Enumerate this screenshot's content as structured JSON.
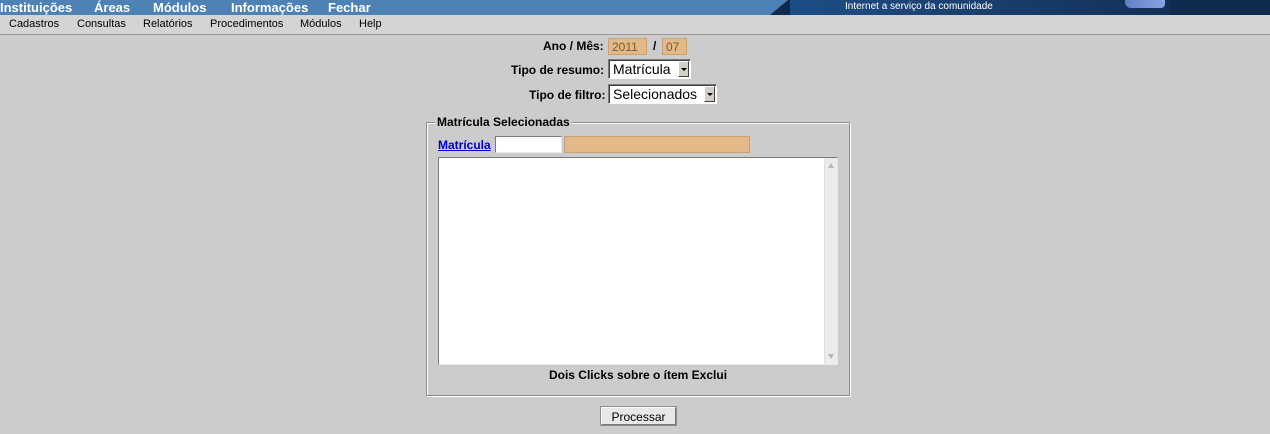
{
  "top_menu": {
    "items": [
      "Instituições",
      "Áreas",
      "Módulos",
      "Informações",
      "Fechar"
    ],
    "tagline": "Internet a serviço da comunidade"
  },
  "sub_menu": {
    "items": [
      "Cadastros",
      "Consultas",
      "Relatórios",
      "Procedimentos",
      "Módulos",
      "Help"
    ]
  },
  "form": {
    "ano_mes_label": "Ano / Mês:",
    "ano_value": "2011",
    "separator": "/",
    "mes_value": "07",
    "tipo_resumo_label": "Tipo de resumo:",
    "tipo_resumo_selected": "Matrícula",
    "tipo_filtro_label": "Tipo de filtro:",
    "tipo_filtro_selected": "Selecionados"
  },
  "panel": {
    "legend": "Matrícula Selecionadas",
    "link_label": "Matrícula",
    "matricula_value": "",
    "description_value": "",
    "list_items": [],
    "hint": "Dois Clicks sobre o ítem Exclui"
  },
  "actions": {
    "process_label": "Processar"
  },
  "colors": {
    "top_bar": "#4f82b4",
    "banner_dark": "#0e2a4d",
    "background": "#cccccc",
    "readonly_input": "#e3b98a",
    "link": "#0000cc"
  }
}
